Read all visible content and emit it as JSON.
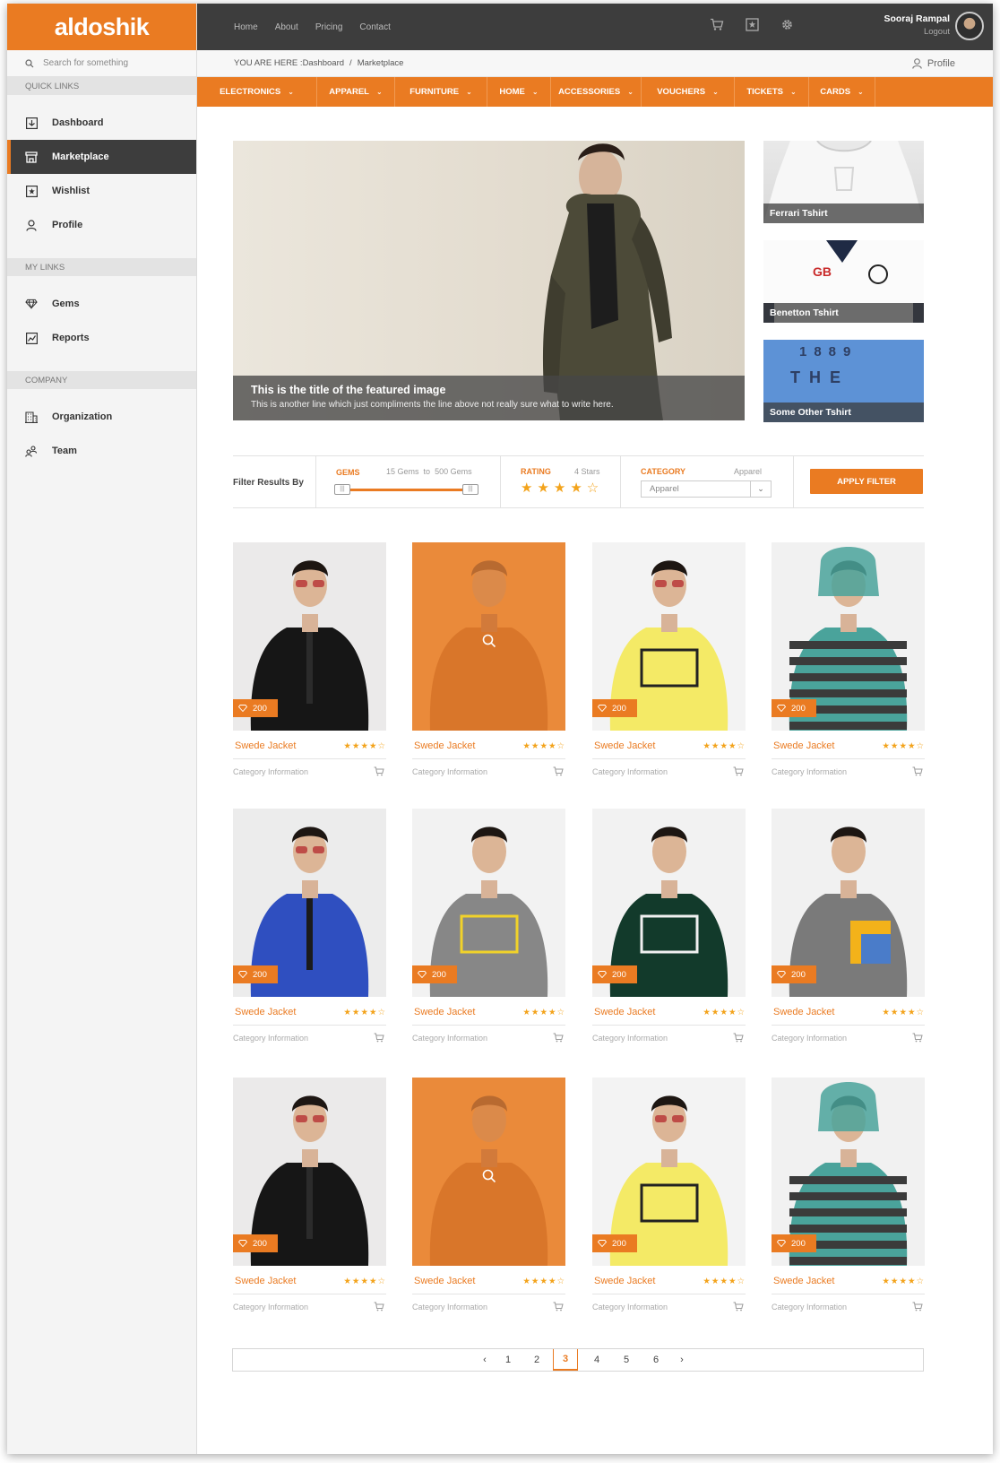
{
  "brand": {
    "logo_text": "aldoshik",
    "accent": "#ea7b22",
    "dark": "#3d3d3d"
  },
  "sidebar": {
    "search_placeholder": "Search for something",
    "sections": [
      {
        "title": "QUICK LINKS",
        "items": [
          {
            "label": "Dashboard",
            "icon": "dashboard-icon"
          },
          {
            "label": "Marketplace",
            "icon": "store-icon",
            "active": true
          },
          {
            "label": "Wishlist",
            "icon": "star-box-icon"
          },
          {
            "label": "Profile",
            "icon": "user-icon"
          }
        ]
      },
      {
        "title": "MY LINKS",
        "items": [
          {
            "label": "Gems",
            "icon": "diamond-icon"
          },
          {
            "label": "Reports",
            "icon": "chart-icon"
          }
        ]
      },
      {
        "title": "COMPANY",
        "items": [
          {
            "label": "Organization",
            "icon": "building-icon"
          },
          {
            "label": "Team",
            "icon": "team-icon"
          }
        ]
      }
    ]
  },
  "topbar": {
    "nav": [
      "Home",
      "About",
      "Pricing",
      "Contact"
    ],
    "icons": [
      "cart-icon",
      "star-box-icon",
      "gear-icon"
    ],
    "user_name": "Sooraj Rampal",
    "logout": "Logout"
  },
  "breadcrumb": {
    "prefix": "YOU ARE HERE : ",
    "items": [
      "Dashboard",
      "Marketplace"
    ],
    "profile_link": "Profile"
  },
  "categories": [
    "ELECTRONICS",
    "APPAREL",
    "FURNITURE",
    "HOME",
    "ACCESSORIES",
    "VOUCHERS",
    "TICKETS",
    "CARDS"
  ],
  "featured": {
    "title": "This is the title of the featured image",
    "subtitle": "This is another line which just compliments the line above not really sure what to write here.",
    "side": [
      "Ferrari Tshirt",
      "Benetton Tshirt",
      "Some Other Tshirt"
    ]
  },
  "filter": {
    "label": "Filter Results By",
    "gems": {
      "label": "GEMS",
      "min": "15 Gems",
      "to": "to",
      "max": "500 Gems"
    },
    "rating": {
      "label": "RATING",
      "value": "4 Stars",
      "stars": 4
    },
    "category": {
      "label": "CATEGORY",
      "hint": "Apparel",
      "selected": "Apparel"
    },
    "apply": "APPLY FILTER"
  },
  "products": [
    {
      "name": "Swede Jacket",
      "category": "Category Information",
      "gems": "200",
      "variant": "black",
      "rating": 4.5
    },
    {
      "name": "Swede Jacket",
      "category": "Category Information",
      "gems": "",
      "variant": "orange",
      "rating": 4.5
    },
    {
      "name": "Swede Jacket",
      "category": "Category Information",
      "gems": "200",
      "variant": "yellow",
      "rating": 4.5
    },
    {
      "name": "Swede Jacket",
      "category": "Category Information",
      "gems": "200",
      "variant": "stripe",
      "rating": 4.5
    },
    {
      "name": "Swede Jacket",
      "category": "Category Information",
      "gems": "200",
      "variant": "blue",
      "rating": 4.5
    },
    {
      "name": "Swede Jacket",
      "category": "Category Information",
      "gems": "200",
      "variant": "grey",
      "rating": 4.5
    },
    {
      "name": "Swede Jacket",
      "category": "Category Information",
      "gems": "200",
      "variant": "green",
      "rating": 4.5
    },
    {
      "name": "Swede Jacket",
      "category": "Category Information",
      "gems": "200",
      "variant": "puma",
      "rating": 4.5
    },
    {
      "name": "Swede Jacket",
      "category": "Category Information",
      "gems": "200",
      "variant": "black",
      "rating": 4.5
    },
    {
      "name": "Swede Jacket",
      "category": "Category Information",
      "gems": "",
      "variant": "orange",
      "rating": 4.5
    },
    {
      "name": "Swede Jacket",
      "category": "Category Information",
      "gems": "200",
      "variant": "yellow",
      "rating": 4.5
    },
    {
      "name": "Swede Jacket",
      "category": "Category Information",
      "gems": "200",
      "variant": "stripe",
      "rating": 4.5
    }
  ],
  "pagination": {
    "pages": [
      "1",
      "2",
      "3",
      "4",
      "5",
      "6"
    ],
    "current": "3",
    "prev": "‹",
    "next": "›"
  }
}
